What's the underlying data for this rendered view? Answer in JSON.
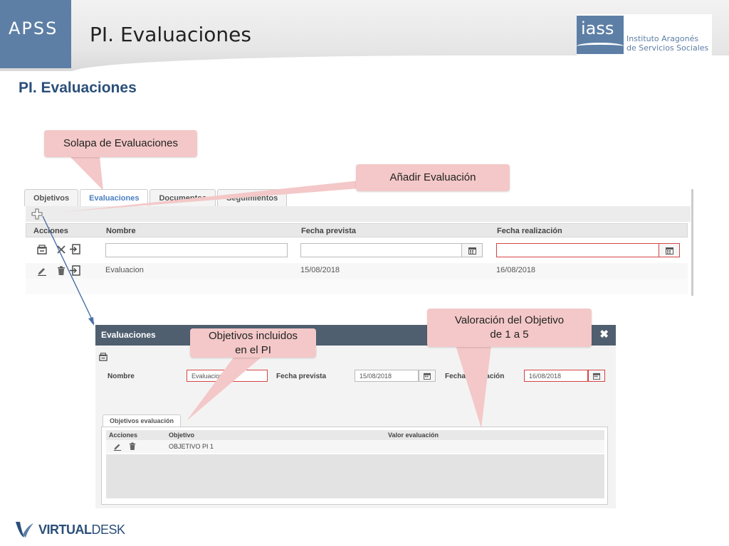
{
  "header": {
    "brand": "APSS",
    "slide_title": "PI. Evaluaciones",
    "logo": {
      "abbrev": "iass",
      "line1": "Instituto Aragonés",
      "line2": "de Servicios Sociales"
    }
  },
  "section_title": "PI. Evaluaciones",
  "callouts": {
    "solapa": "Solapa de Evaluaciones",
    "anadir": "Añadir Evaluación",
    "objetivos_line1": "Objetivos incluidos",
    "objetivos_line2": "en el PI",
    "valoracion_line1": "Valoración del Objetivo",
    "valoracion_line2": "de 1 a 5"
  },
  "tabs": [
    "Objetivos",
    "Evaluaciones",
    "Documentos",
    "Seguimientos"
  ],
  "active_tab": "Evaluaciones",
  "grid": {
    "columns": [
      "Acciones",
      "Nombre",
      "Fecha prevista",
      "Fecha realización"
    ],
    "rows": [
      {
        "nombre": "Evaluacion",
        "fecha_prevista": "15/08/2018",
        "fecha_realizacion": "16/08/2018"
      }
    ]
  },
  "dialog": {
    "title": "Evaluaciones",
    "labels": {
      "nombre": "Nombre",
      "fecha_prevista": "Fecha prevista",
      "fecha_realizacion": "Fecha realización"
    },
    "values": {
      "nombre": "Evaluacion",
      "fecha_prevista": "15/08/2018",
      "fecha_realizacion": "16/08/2018"
    },
    "inner_tab": "Objetivos evaluación",
    "grid_columns": [
      "Acciones",
      "Objetivo",
      "Valor evaluación"
    ],
    "grid_rows": [
      {
        "objetivo": "OBJETIVO PI 1",
        "valor": ""
      }
    ]
  },
  "footer": {
    "brand_bold": "VIRTUAL",
    "brand_light": "DESK"
  },
  "colors": {
    "accent_blue": "#5d7fa6",
    "title_blue": "#2a4f7a",
    "callout_pink": "#f4c8c8",
    "error_red": "#d64545",
    "dialog_header": "#4f5f70"
  }
}
